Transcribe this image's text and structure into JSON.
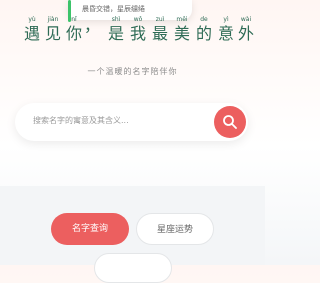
{
  "top_toast": {
    "text": "晨昏交错，星辰缱绻"
  },
  "headline": [
    {
      "pinyin": "yù",
      "hanzi": "遇"
    },
    {
      "pinyin": "jiàn",
      "hanzi": "见"
    },
    {
      "pinyin": "nǐ",
      "hanzi": "你"
    },
    {
      "pinyin": "",
      "hanzi": "，"
    },
    {
      "pinyin": "shì",
      "hanzi": "是"
    },
    {
      "pinyin": "wǒ",
      "hanzi": "我"
    },
    {
      "pinyin": "zuì",
      "hanzi": "最"
    },
    {
      "pinyin": "měi",
      "hanzi": "美"
    },
    {
      "pinyin": "de",
      "hanzi": "的"
    },
    {
      "pinyin": "yì",
      "hanzi": "意"
    },
    {
      "pinyin": "wài",
      "hanzi": "外"
    }
  ],
  "subtitle": "一个温暖的名字陪伴你",
  "search": {
    "placeholder": "搜索名字的寓意及其含义..."
  },
  "buttons": {
    "primary": "名字查询",
    "secondary": "星座运势",
    "more": ""
  },
  "colors": {
    "accent": "#ec5f5f",
    "headline": "#2e6b55",
    "toast_accent": "#3cc36a"
  }
}
